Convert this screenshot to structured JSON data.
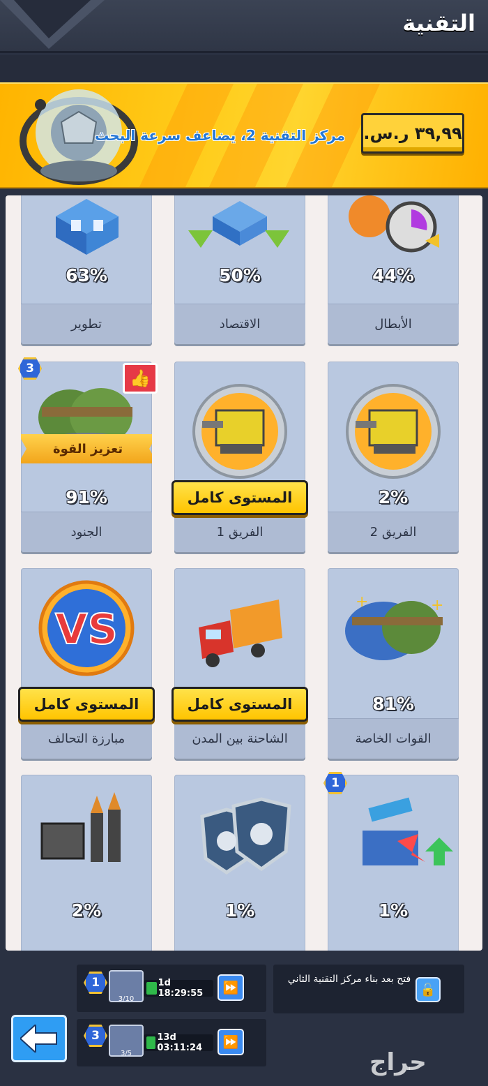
{
  "header": {
    "title": "التقنية"
  },
  "banner": {
    "promo_text": "مركز التقنية 2، يضاعف سرعة البحث",
    "price_label": "٣٩,٩٩ ر.س."
  },
  "grid": {
    "row1": [
      {
        "name": "تطوير",
        "percent": "63%"
      },
      {
        "name": "الاقتصاد",
        "percent": "50%"
      },
      {
        "name": "الأبطال",
        "percent": "44%"
      }
    ],
    "row2": [
      {
        "name": "الجنود",
        "percent": "91%",
        "badge": "3",
        "ribbon": "تعزيز القوة"
      },
      {
        "name": "الفريق 1",
        "ribbon": "المستوى كامل"
      },
      {
        "name": "الفريق 2",
        "percent": "2%"
      }
    ],
    "row3": [
      {
        "name": "مبارزة التحالف",
        "ribbon": "المستوى كامل"
      },
      {
        "name": "الشاحنة بين المدن",
        "ribbon": "المستوى كامل"
      },
      {
        "name": "القوات الخاصة",
        "percent": "81%"
      }
    ],
    "row4": [
      {
        "percent": "2%"
      },
      {
        "percent": "1%"
      },
      {
        "percent": "1%",
        "badge": "1"
      }
    ]
  },
  "queues": [
    {
      "level": "1",
      "fraction": "3/10",
      "timer": "1d 18:29:55"
    },
    {
      "level": "3",
      "fraction": "3/5",
      "timer": "13d 03:11:24"
    }
  ],
  "locked_slot": {
    "text": "فتح بعد بناء مركز التقنية الثاني"
  },
  "watermark": "حراج",
  "colors": {
    "accent_yellow": "#ffcc1a",
    "card_blue": "#b9c8e0",
    "button_blue": "#2f9df3"
  }
}
